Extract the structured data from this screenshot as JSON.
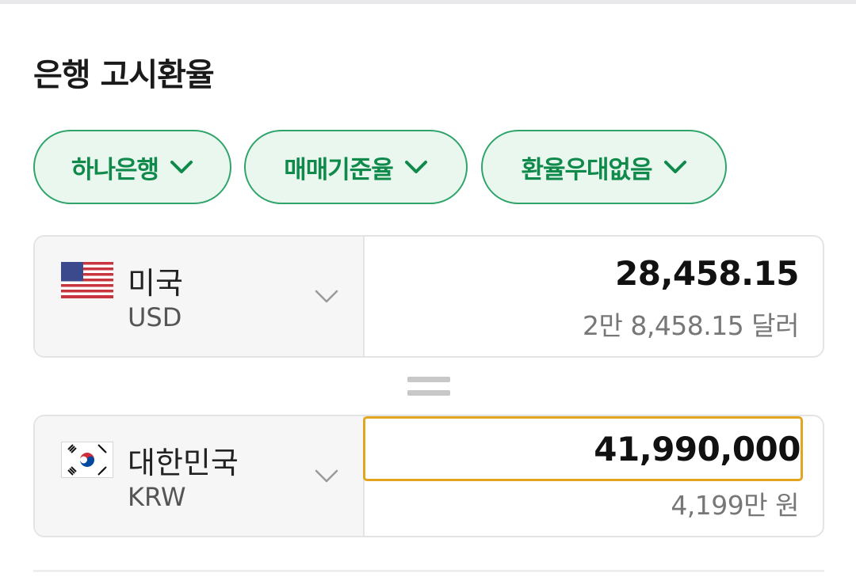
{
  "title": "은행 고시환율",
  "filters": [
    {
      "label": "하나은행"
    },
    {
      "label": "매매기준율"
    },
    {
      "label": "환율우대없음"
    }
  ],
  "from": {
    "country": "미국",
    "code": "USD",
    "amount": "28,458.15",
    "amount_text": "2만 8,458.15 달러",
    "flag_icon": "us-flag-icon"
  },
  "to": {
    "country": "대한민국",
    "code": "KRW",
    "amount": "41,990,000",
    "amount_text": "4,199만 원",
    "flag_icon": "kr-flag-icon"
  },
  "colors": {
    "accent_green": "#0f8a4b",
    "chip_bg": "#e9f7ef",
    "focus_border": "#e3a51f"
  }
}
